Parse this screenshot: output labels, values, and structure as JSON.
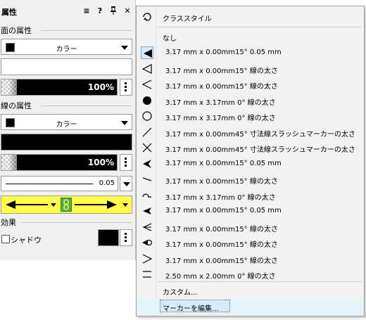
{
  "panel": {
    "title": "属性",
    "fill_section": "面の属性",
    "fill_type": "カラー",
    "fill_opacity": "100%",
    "line_section": "線の属性",
    "line_type": "カラー",
    "line_opacity": "100%",
    "line_weight": "0.05",
    "effects_section": "効果",
    "shadow_label": "シャドウ",
    "colors": {
      "highlight": "#ffff44",
      "link": "#4caf50"
    }
  },
  "menu": {
    "class_style": "クラススタイル",
    "none": "なし",
    "items": [
      {
        "label": "3.17 mm x 0.00mm15°  0.05 mm",
        "icon": "filled-arrow-icon"
      },
      {
        "label": "3.17 mm x 0.00mm15°  線の太さ",
        "icon": "open-triangle-arrow-icon"
      },
      {
        "label": "3.17 mm x 0.00mm15°  線の太さ",
        "icon": "open-arrow-icon"
      },
      {
        "label": "3.17 mm x 3.17mm  0°  線の太さ",
        "icon": "filled-circle-icon"
      },
      {
        "label": "3.17 mm x 3.17mm  0°  線の太さ",
        "icon": "open-circle-icon"
      },
      {
        "label": "3.17 mm x 0.00mm45°  寸法線スラッシュマーカーの太さ",
        "icon": "slash-icon"
      },
      {
        "label": "3.17 mm x 0.00mm45°  寸法線スラッシュマーカーの太さ",
        "icon": "cross-icon"
      },
      {
        "label": "3.17 mm x 0.00mm15°  0.05 mm",
        "icon": "barbed-arrow-icon"
      },
      {
        "label": "3.17 mm x 0.00mm15°  線の太さ",
        "icon": "half-arrow-icon"
      },
      {
        "label": "3.17 mm x 3.17mm  0°  線の太さ",
        "icon": "half-circle-icon"
      },
      {
        "label": "3.17 mm x 0.00mm15°  0.05 mm",
        "icon": "filled-barbed-arrow-icon"
      },
      {
        "label": "3.17 mm x 0.00mm15°  線の太さ",
        "icon": "open-barbed-arrow-icon"
      },
      {
        "label": "3.17 mm x 0.00mm15°  線の太さ",
        "icon": "arrow-circle-icon"
      },
      {
        "label": "3.17 mm x 0.00mm15°  線の太さ",
        "icon": "open-arrow-right-icon"
      },
      {
        "label": "2.50 mm x 2.00mm  0°  線の太さ",
        "icon": "double-line-icon"
      }
    ],
    "custom": "カスタム...",
    "edit_markers": "マーカーを編集..."
  }
}
